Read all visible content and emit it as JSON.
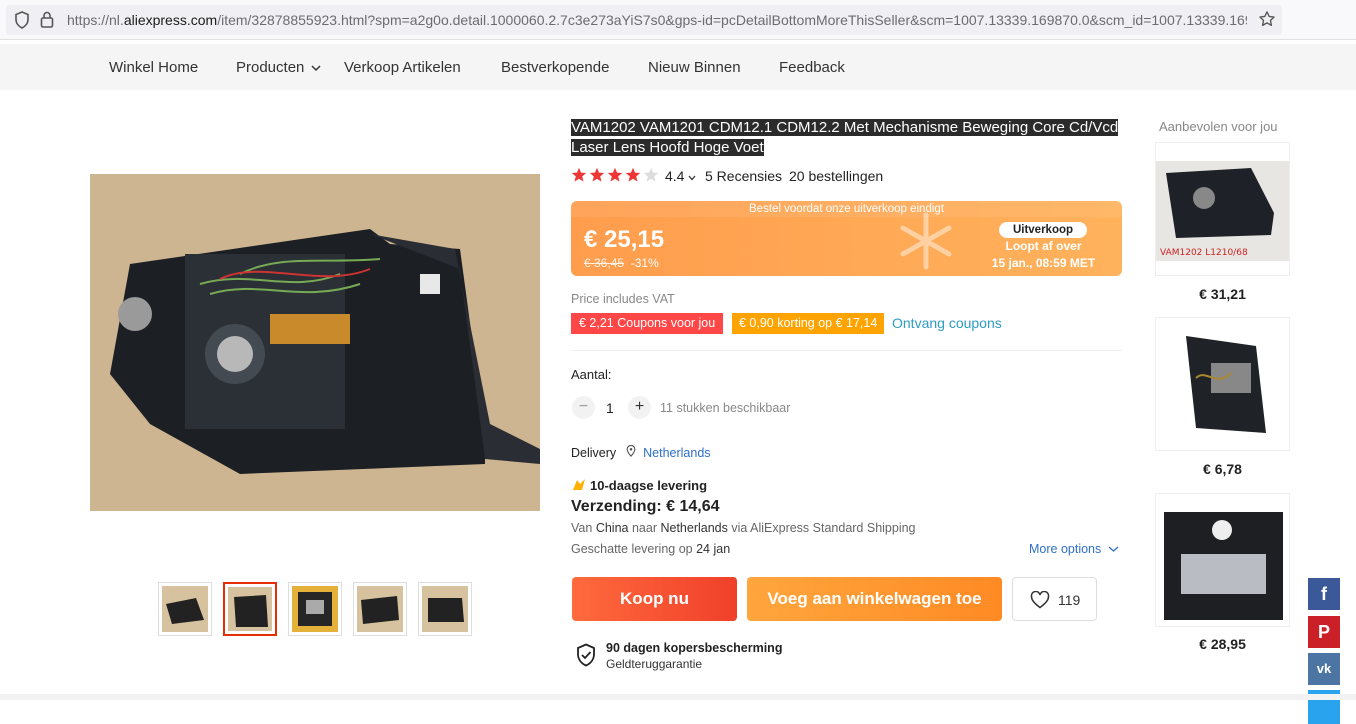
{
  "browser": {
    "url_prefix": "https://nl.",
    "url_domain": "aliexpress.com",
    "url_rest": "/item/32878855923.html?spm=a2g0o.detail.1000060.2.7c3e273aYiS7s0&gps-id=pcDetailBottomMoreThisSeller&scm=1007.13339.169870.0&scm_id=1007.13339.169"
  },
  "storenav": {
    "items": [
      "Winkel Home",
      "Producten",
      "Verkoop Artikelen",
      "Bestverkopende",
      "Nieuw Binnen",
      "Feedback"
    ]
  },
  "product": {
    "title": "VAM1202 VAM1201 CDM12.1 CDM12.2 Met Mechanisme Beweging Core Cd/Vcd Laser Lens Hoofd Hoge Voet",
    "rating": "4.4",
    "reviews": "5 Recensies",
    "orders": "20 bestellingen",
    "stars": 4.4
  },
  "price": {
    "banner": "Bestel voordat onze uitverkoop eindigt",
    "current": "€ 25,15",
    "old": "€ 36,45",
    "discount": "-31%",
    "sale_pill": "Uitverkoop",
    "ends_label": "Loopt af over",
    "ends_date": "15 jan., 08:59 MET"
  },
  "vat": "Price includes VAT",
  "coupons": {
    "coupon1": "€ 2,21 Coupons voor jou",
    "coupon2": "€ 0,90 korting op € 17,14",
    "link": "Ontvang coupons"
  },
  "quantity": {
    "label": "Aantal:",
    "value": "1",
    "available": "11 stukken beschikbaar"
  },
  "delivery": {
    "label": "Delivery",
    "location": "Netherlands",
    "fast": "10-daagse levering",
    "shipping": "Verzending: € 14,64",
    "route_van": "Van",
    "route_from": "China",
    "route_naar": "naar",
    "route_to": "Netherlands",
    "route_via": "via AliExpress Standard Shipping",
    "eta_label": "Geschatte levering op",
    "eta_date": "24 jan",
    "more": "More options"
  },
  "buttons": {
    "buy": "Koop nu",
    "cart": "Voeg aan winkelwagen toe",
    "wish_count": "119"
  },
  "protection": {
    "title": "90 dagen kopersbescherming",
    "subtitle": "Geldteruggarantie"
  },
  "recommendations": {
    "title": "Aanbevolen voor jou",
    "items": [
      {
        "price": "€ 31,21",
        "caption": "VAM1202  L1210/68"
      },
      {
        "price": "€ 6,78"
      },
      {
        "price": "€ 28,95"
      }
    ]
  },
  "colors": {
    "accent_red": "#f0402a",
    "accent_orange": "#ff8a24",
    "link_blue": "#2e9cc3"
  }
}
